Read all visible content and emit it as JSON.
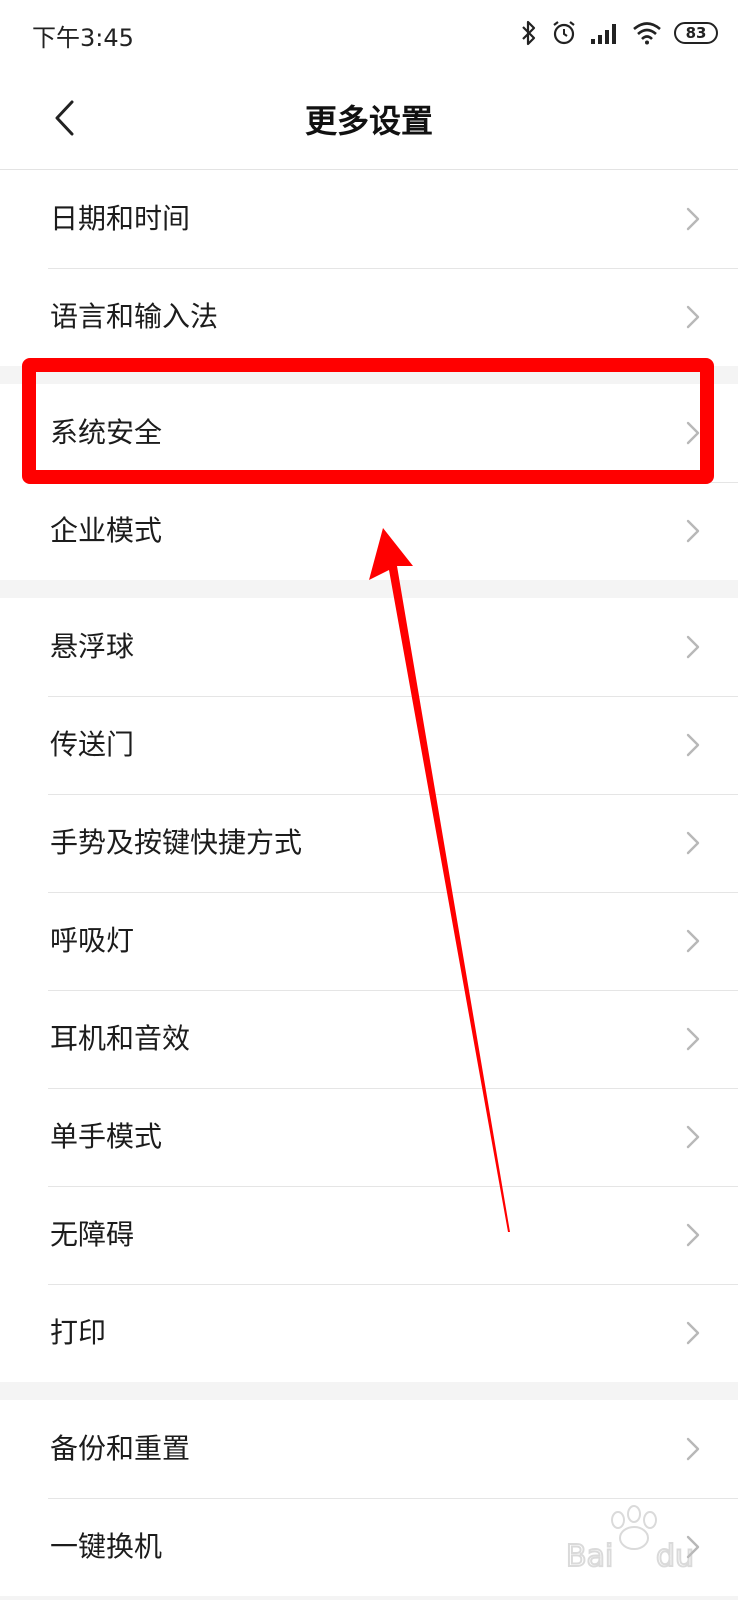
{
  "status_bar": {
    "time": "下午3:45",
    "battery": "83",
    "icons": [
      "bluetooth-icon",
      "alarm-icon",
      "signal-icon",
      "wifi-icon",
      "battery-icon"
    ]
  },
  "header": {
    "title": "更多设置",
    "back_icon": "chevron-left-icon"
  },
  "groups": [
    {
      "items": [
        {
          "label": "日期和时间"
        },
        {
          "label": "语言和输入法"
        }
      ]
    },
    {
      "items": [
        {
          "label": "系统安全"
        },
        {
          "label": "企业模式"
        }
      ]
    },
    {
      "items": [
        {
          "label": "悬浮球"
        },
        {
          "label": "传送门"
        },
        {
          "label": "手势及按键快捷方式"
        },
        {
          "label": "呼吸灯"
        },
        {
          "label": "耳机和音效"
        },
        {
          "label": "单手模式"
        },
        {
          "label": "无障碍"
        },
        {
          "label": "打印"
        }
      ]
    },
    {
      "items": [
        {
          "label": "备份和重置"
        },
        {
          "label": "一键换机"
        }
      ]
    }
  ],
  "annotation": {
    "highlight_color": "#ff0000",
    "highlighted_item": "系统安全"
  },
  "colors": {
    "background": "#f4f4f4",
    "surface": "#ffffff",
    "divider": "#e5e5e5",
    "chevron": "#b8b8b8"
  }
}
